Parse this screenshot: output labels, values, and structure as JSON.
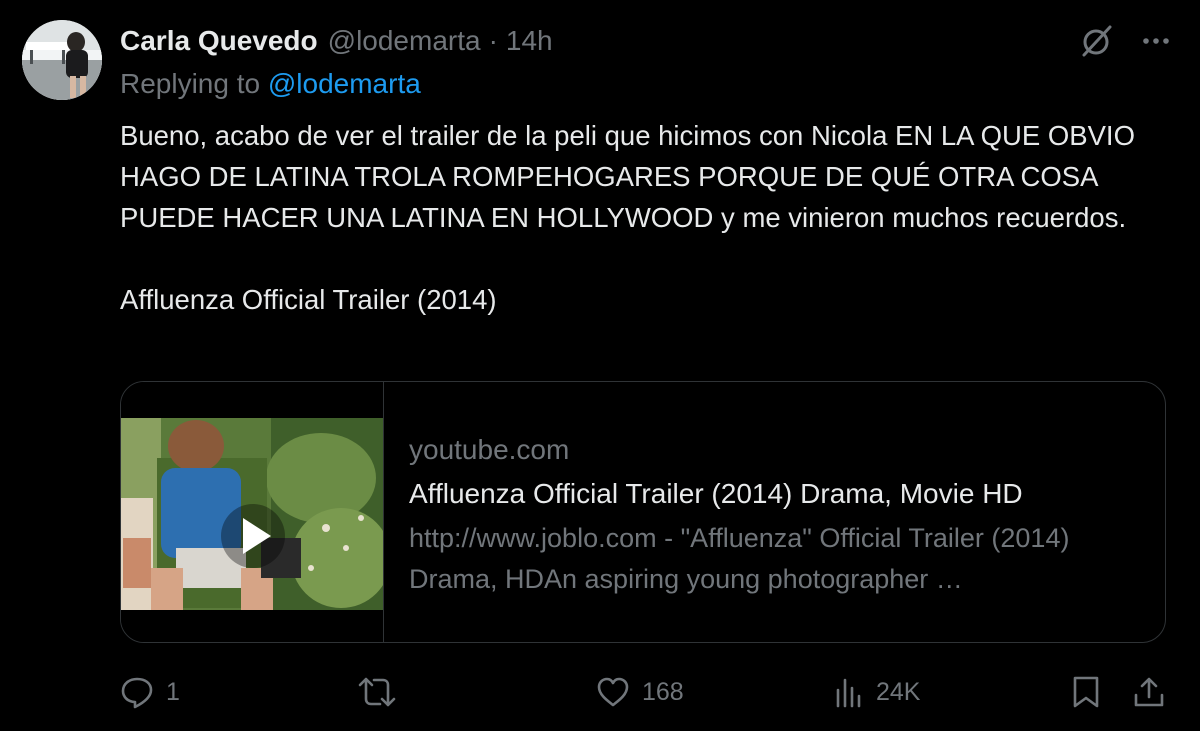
{
  "tweet": {
    "author_name": "Carla Quevedo",
    "handle": "@lodemarta",
    "separator": "·",
    "time": "14h",
    "replying_prefix": "Replying to",
    "replying_handle": "@lodemarta",
    "text_paragraph_1": "Bueno, acabo de ver el trailer de la peli que hicimos con Nicola EN LA QUE OBVIO HAGO DE LATINA TROLA ROMPEHOGARES PORQUE DE QUÉ OTRA COSA PUEDE HACER UNA LATINA EN HOLLYWOOD y me vinieron muchos recuerdos.",
    "text_paragraph_2": "Affluenza Official Trailer (2014)"
  },
  "header_icons": {
    "grok": "grok-icon",
    "more": "more-icon"
  },
  "card": {
    "domain": "youtube.com",
    "title": "Affluenza Official Trailer (2014) Drama, Movie HD",
    "description": "http://www.joblo.com - \"Affluenza\" Official Trailer (2014) Drama, HDAn aspiring young photographer …",
    "play_icon": "play-icon"
  },
  "actions": {
    "reply_icon": "reply-icon",
    "reply_count": "1",
    "retweet_icon": "retweet-icon",
    "retweet_count": "",
    "like_icon": "heart-icon",
    "like_count": "168",
    "views_icon": "views-icon",
    "views_count": "24K",
    "bookmark_icon": "bookmark-icon",
    "share_icon": "share-icon"
  },
  "colors": {
    "background": "#000000",
    "text_primary": "#e7e9ea",
    "text_secondary": "#71767b",
    "link": "#1d9bf0",
    "border": "#2f3336"
  }
}
